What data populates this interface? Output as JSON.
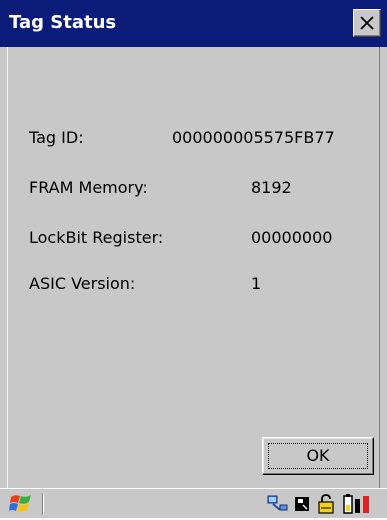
{
  "window": {
    "title": "Tag Status",
    "close_label": "×"
  },
  "fields": [
    {
      "label": "Tag ID:",
      "value": "000000005575FB77"
    },
    {
      "label": "FRAM Memory:",
      "value": "8192"
    },
    {
      "label": "LockBit Register:",
      "value": "00000000"
    },
    {
      "label": "ASIC Version:",
      "value": "1"
    }
  ],
  "buttons": {
    "ok_label": "OK"
  },
  "taskbar": {
    "start_icon": "windows-flag-icon",
    "tray_icons": [
      "network-connection-icon",
      "input-panel-icon",
      "lock-icon",
      "battery-icon"
    ]
  },
  "colors": {
    "titlebar": "#0a1b78",
    "title_text": "#ffffff",
    "face": "#c8c8c8"
  }
}
